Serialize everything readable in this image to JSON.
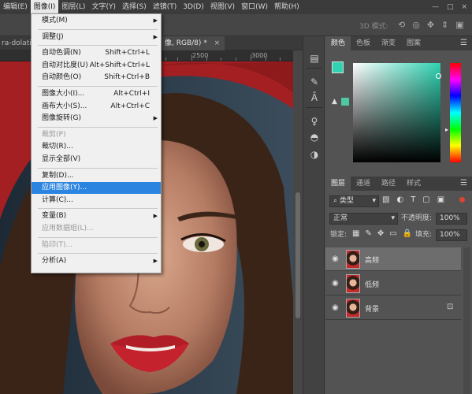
{
  "menubar": {
    "items": [
      "编辑(E)",
      "图像(I)",
      "图层(L)",
      "文字(Y)",
      "选择(S)",
      "滤镜(T)",
      "3D(D)",
      "视图(V)",
      "窗口(W)",
      "帮助(H)"
    ],
    "active_index": 1,
    "win_minimize": "—",
    "win_maximize": "□",
    "win_close": "×"
  },
  "optbar": {
    "mode3d": "3D 模式:"
  },
  "tabs": {
    "left": "ra-dolati-c",
    "right": "像, RGB/8) *",
    "close": "×"
  },
  "ruler": {
    "labels": [
      "2500",
      "3000"
    ]
  },
  "image_menu": {
    "items": [
      {
        "label": "模式(M)",
        "shortcut": "",
        "submenu": true,
        "disabled": false
      },
      {
        "label": "调整(J)",
        "shortcut": "",
        "submenu": true,
        "disabled": false
      },
      {
        "label": "自动色调(N)",
        "shortcut": "Shift+Ctrl+L",
        "submenu": false,
        "disabled": false
      },
      {
        "label": "自动对比度(U)",
        "shortcut": "Alt+Shift+Ctrl+L",
        "submenu": false,
        "disabled": false
      },
      {
        "label": "自动颜色(O)",
        "shortcut": "Shift+Ctrl+B",
        "submenu": false,
        "disabled": false
      },
      {
        "label": "图像大小(I)...",
        "shortcut": "Alt+Ctrl+I",
        "submenu": false,
        "disabled": false
      },
      {
        "label": "画布大小(S)...",
        "shortcut": "Alt+Ctrl+C",
        "submenu": false,
        "disabled": false
      },
      {
        "label": "图像旋转(G)",
        "shortcut": "",
        "submenu": true,
        "disabled": false
      },
      {
        "label": "裁剪(P)",
        "shortcut": "",
        "submenu": false,
        "disabled": true
      },
      {
        "label": "裁切(R)...",
        "shortcut": "",
        "submenu": false,
        "disabled": false
      },
      {
        "label": "显示全部(V)",
        "shortcut": "",
        "submenu": false,
        "disabled": false
      },
      {
        "label": "复制(D)...",
        "shortcut": "",
        "submenu": false,
        "disabled": false
      },
      {
        "label": "应用图像(Y)...",
        "shortcut": "",
        "submenu": false,
        "disabled": false,
        "highlighted": true
      },
      {
        "label": "计算(C)...",
        "shortcut": "",
        "submenu": false,
        "disabled": false
      },
      {
        "label": "变量(B)",
        "shortcut": "",
        "submenu": true,
        "disabled": false
      },
      {
        "label": "应用数据组(L)...",
        "shortcut": "",
        "submenu": false,
        "disabled": true
      },
      {
        "label": "陷印(T)...",
        "shortcut": "",
        "submenu": false,
        "disabled": true
      },
      {
        "label": "分析(A)",
        "shortcut": "",
        "submenu": true,
        "disabled": false
      }
    ]
  },
  "color_panel": {
    "tabs": [
      "颜色",
      "色板",
      "渐变",
      "图案"
    ],
    "active_tab": 0,
    "foreground": "#2fd3b2",
    "gamut_warning": "▲"
  },
  "layers_panel": {
    "tabs": [
      "图层",
      "通道",
      "路径",
      "样式"
    ],
    "active_tab": 0,
    "filter_kind": "类型",
    "blend_mode": "正常",
    "opacity_label": "不透明度:",
    "opacity_value": "100%",
    "lock_label": "锁定:",
    "fill_label": "填充:",
    "fill_value": "100%",
    "layers": [
      {
        "name": "高频",
        "selected": true,
        "locked": false
      },
      {
        "name": "低频",
        "selected": false,
        "locked": false
      },
      {
        "name": "背景",
        "selected": false,
        "locked": true
      }
    ]
  },
  "icons": {
    "menu": "☰",
    "eye": "◉",
    "lock": "🔒",
    "submenu_arrow": "▶",
    "dropdown_arrow": "▾"
  }
}
